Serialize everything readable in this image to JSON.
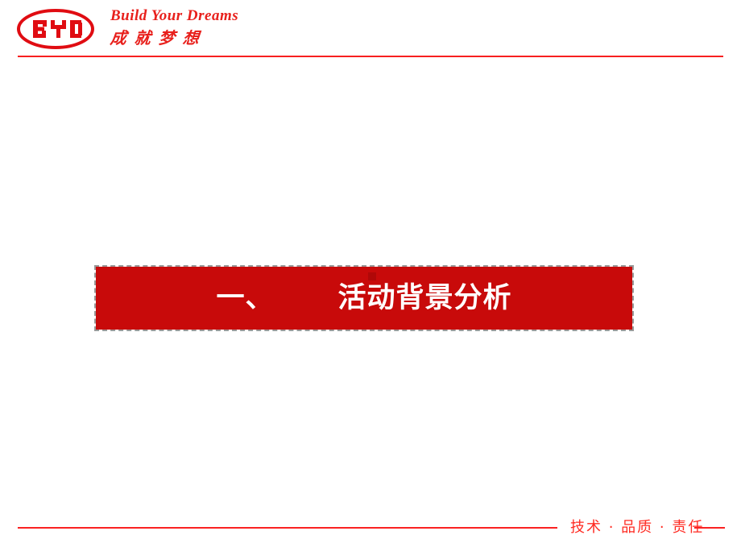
{
  "slide": {
    "background_color": "#FFFFFF",
    "accent_color": "#C80A0A",
    "rule_color": "#F82020"
  },
  "header": {
    "logo": {
      "brand_text": "BYD",
      "shape": "ellipse-outline",
      "color": "#E00C12"
    },
    "slogan": {
      "english": "Build Your Dreams",
      "chinese": "成就梦想",
      "color": "#E8201C"
    },
    "rule": {
      "name": "header-divider",
      "color": "#F82020"
    }
  },
  "main": {
    "section_banner": {
      "number_label": "一、",
      "title": "活动背景分析",
      "full_text": "一、      活动背景分析",
      "background_color": "#C80A0A",
      "text_color": "#FFFFFF",
      "selected": true,
      "selection_style": "dashed"
    }
  },
  "footer": {
    "tagline": "技术 · 品质 · 责任",
    "tagline_color": "#FF2A21",
    "rule_color": "#FA2222"
  }
}
